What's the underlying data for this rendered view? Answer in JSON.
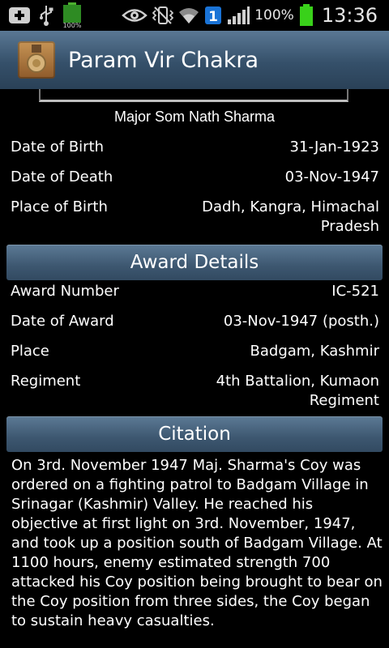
{
  "status_bar": {
    "battery_small_label": "100%",
    "battery_percent": "100%",
    "time": "13:36",
    "notification_count": "1",
    "icons": [
      "add-icon",
      "usb-icon",
      "battery-notification-icon",
      "eye-icon",
      "vibrate-icon",
      "wifi-icon",
      "badge-icon",
      "signal-icon",
      "battery-icon"
    ]
  },
  "action_bar": {
    "title": "Param Vir Chakra",
    "icon": "medal-icon"
  },
  "person": {
    "name": "Major Som Nath Sharma",
    "rows": [
      {
        "label": "Date of Birth",
        "value": "31-Jan-1923"
      },
      {
        "label": "Date of Death",
        "value": "03-Nov-1947"
      },
      {
        "label": "Place of Birth",
        "value": "Dadh, Kangra, Himachal Pradesh"
      }
    ]
  },
  "award": {
    "header": "Award Details",
    "rows": [
      {
        "label": "Award Number",
        "value": "IC-521"
      },
      {
        "label": "Date of Award",
        "value": "03-Nov-1947 (posth.)"
      },
      {
        "label": "Place",
        "value": "Badgam, Kashmir"
      },
      {
        "label": "Regiment",
        "value": "4th Battalion, Kumaon Regiment"
      }
    ]
  },
  "citation": {
    "header": "Citation",
    "text": "On 3rd. November 1947 Maj. Sharma's Coy was ordered on a fighting patrol to Badgam Village in Srinagar (Kashmir) Valley. He reached his objective at first light on 3rd. November, 1947, and took up a position south of Badgam Village. At 1100 hours, enemy estimated strength 700 attacked his Coy position being brought to bear on the Coy position from three sides, the Coy began to sustain heavy casualties."
  },
  "colors": {
    "background": "#000000",
    "header_blue": "#3d5770",
    "battery_green": "#39d11a"
  }
}
